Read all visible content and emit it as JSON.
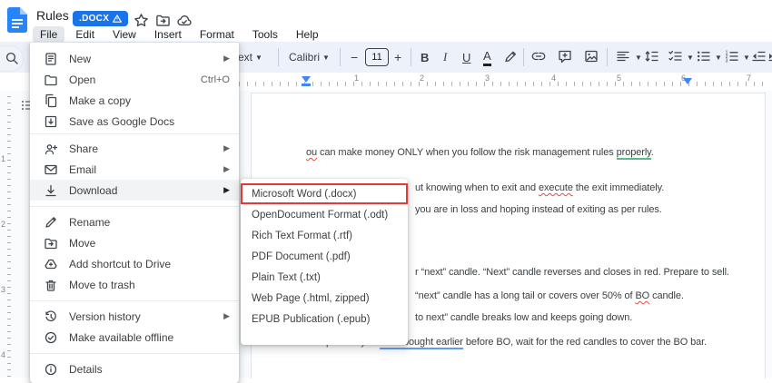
{
  "titlebar": {
    "title": "Rules",
    "badge": ".DOCX",
    "menus": [
      "File",
      "Edit",
      "View",
      "Insert",
      "Format",
      "Tools",
      "Help"
    ],
    "active_menu": "File"
  },
  "toolbar": {
    "style_partial": "ext",
    "font_name": "Calibri",
    "decrease_size": "−",
    "font_size": "11",
    "increase_size": "+",
    "bold": "B",
    "italic": "I",
    "underline": "U",
    "text_color": "A"
  },
  "ruler": {
    "numbers": [
      "1",
      "2",
      "3",
      "4",
      "5",
      "6",
      "7"
    ]
  },
  "vruler": {
    "numbers": [
      "1",
      "2",
      "3",
      "4"
    ]
  },
  "file_menu": {
    "items": [
      {
        "label": "New",
        "shortcut": "",
        "icon": "new-document-icon",
        "has_submenu": true
      },
      {
        "label": "Open",
        "shortcut": "Ctrl+O",
        "icon": "folder-open-icon",
        "has_submenu": false
      },
      {
        "label": "Make a copy",
        "shortcut": "",
        "icon": "copy-icon",
        "has_submenu": false
      },
      {
        "label": "Save as Google Docs",
        "shortcut": "",
        "icon": "save-google-docs-icon",
        "has_submenu": false
      },
      {
        "label": "Share",
        "shortcut": "",
        "icon": "share-person-icon",
        "has_submenu": true
      },
      {
        "label": "Email",
        "shortcut": "",
        "icon": "email-icon",
        "has_submenu": true
      },
      {
        "label": "Download",
        "shortcut": "",
        "icon": "download-icon",
        "has_submenu": true,
        "highlighted": true
      },
      {
        "label": "Rename",
        "shortcut": "",
        "icon": "rename-pencil-icon",
        "has_submenu": false
      },
      {
        "label": "Move",
        "shortcut": "",
        "icon": "move-folder-icon",
        "has_submenu": false
      },
      {
        "label": "Add shortcut to Drive",
        "shortcut": "",
        "icon": "drive-shortcut-icon",
        "has_submenu": false
      },
      {
        "label": "Move to trash",
        "shortcut": "",
        "icon": "trash-icon",
        "has_submenu": false
      },
      {
        "label": "Version history",
        "shortcut": "",
        "icon": "version-history-icon",
        "has_submenu": true
      },
      {
        "label": "Make available offline",
        "shortcut": "",
        "icon": "offline-check-icon",
        "has_submenu": false
      },
      {
        "label": "Details",
        "shortcut": "",
        "icon": "details-info-icon",
        "has_submenu": false
      }
    ]
  },
  "download_menu": {
    "highlighted_item": "Microsoft Word (.docx)",
    "items": [
      {
        "label": "Microsoft Word (.docx)"
      },
      {
        "label": "OpenDocument Format (.odt)"
      },
      {
        "label": "Rich Text Format (.rtf)"
      },
      {
        "label": "PDF Document (.pdf)"
      },
      {
        "label": "Plain Text (.txt)"
      },
      {
        "label": "Web Page (.html, zipped)"
      },
      {
        "label": "EPUB Publication (.epub)"
      }
    ]
  },
  "document": {
    "lines": [
      {
        "segments": [
          {
            "text": "ou",
            "style": "misspelling-red-squiggle"
          },
          {
            "text": " can make money ONLY when you follow the risk management rules ",
            "style": ""
          },
          {
            "text": "properly",
            "style": "suggestion-green-underline"
          },
          {
            "text": ".",
            "style": ""
          }
        ]
      },
      {
        "segments": [
          {
            "text": "ut knowing when to exit and ",
            "style": ""
          },
          {
            "text": "execute",
            "style": "misspelling-red-squiggle"
          },
          {
            "text": " the exit immediately.",
            "style": ""
          }
        ]
      },
      {
        "segments": [
          {
            "text": "you are in loss and hoping instead of exiting as per rules.",
            "style": ""
          }
        ]
      },
      {
        "segments": [
          {
            "text": "r “next” candle. “Next” candle reverses and closes in red. Prepare to sell.",
            "style": ""
          }
        ]
      },
      {
        "segments": [
          {
            "text": "“next” candle has a long tail or covers over 50% of ",
            "style": ""
          },
          {
            "text": "BO",
            "style": "misspelling-red-squiggle"
          },
          {
            "text": " candle.",
            "style": ""
          }
        ]
      },
      {
        "segments": [
          {
            "text": "to next” candle breaks low and keeps going down.",
            "style": ""
          }
        ]
      },
      {
        "segments": [
          {
            "text": "Exception: If you ",
            "style": ""
          },
          {
            "text": "have bought earlier",
            "style": "suggestion-blue-underline"
          },
          {
            "text": " before BO, wait for the red candles to cover the BO bar.",
            "style": ""
          }
        ]
      }
    ]
  },
  "colors": {
    "accent_blue": "#1a73e8",
    "marker_blue": "#4285f4",
    "highlight_box_red": "#e53935",
    "squiggle_red": "#e5483e",
    "suggestion_green": "#57bb8a",
    "suggestion_blue": "#6199f6",
    "toolbar_bg": "#edf2fa"
  }
}
